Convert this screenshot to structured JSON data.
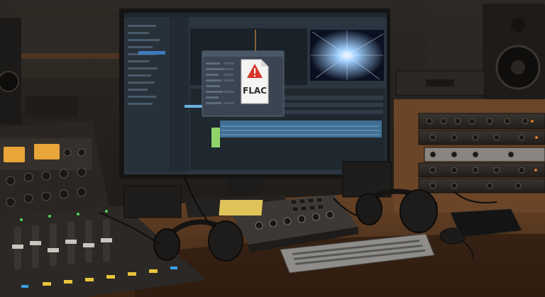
{
  "scene": {
    "description_colors": {
      "wall": "#2a241f",
      "desk": "#5a3a22",
      "screen_bg": "#2b3540",
      "accent_orange": "#e89a3a",
      "warning_red": "#d9362b"
    }
  },
  "file_icon": {
    "label": "FLAC"
  },
  "monitor": {
    "brand_mark": ""
  }
}
